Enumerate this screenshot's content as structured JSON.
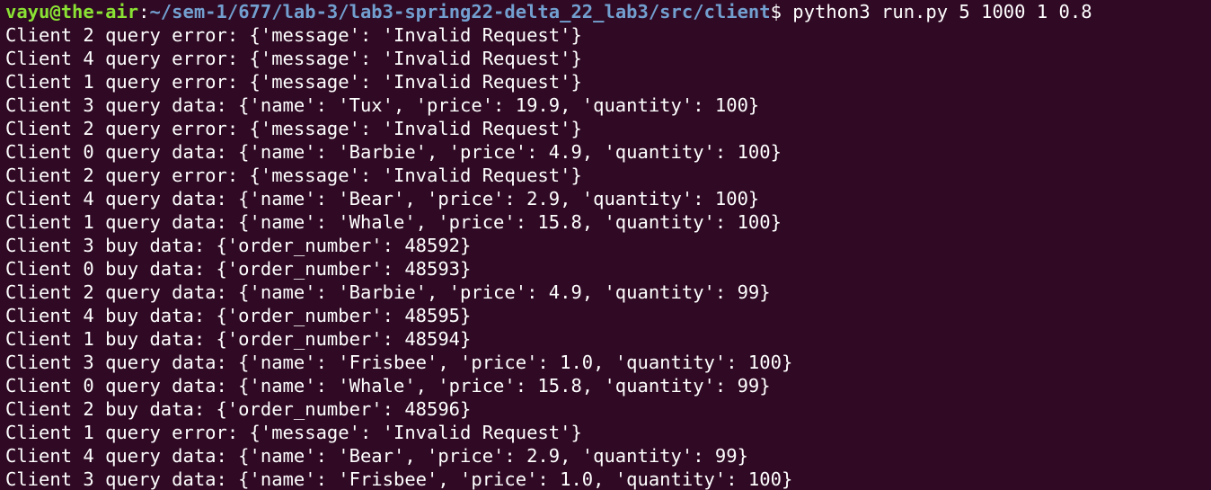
{
  "prompt": {
    "user_host": "vayu@the-air",
    "separator": ":",
    "path": "~/sem-1/677/lab-3/lab3-spring22-delta_22_lab3/src/client",
    "symbol": "$",
    "command": " python3 run.py 5 1000 1 0.8"
  },
  "output_lines": [
    "Client 2 query error: {'message': 'Invalid Request'}",
    "Client 4 query error: {'message': 'Invalid Request'}",
    "Client 1 query error: {'message': 'Invalid Request'}",
    "Client 3 query data: {'name': 'Tux', 'price': 19.9, 'quantity': 100}",
    "Client 2 query error: {'message': 'Invalid Request'}",
    "Client 0 query data: {'name': 'Barbie', 'price': 4.9, 'quantity': 100}",
    "Client 2 query error: {'message': 'Invalid Request'}",
    "Client 4 query data: {'name': 'Bear', 'price': 2.9, 'quantity': 100}",
    "Client 1 query data: {'name': 'Whale', 'price': 15.8, 'quantity': 100}",
    "Client 3 buy data: {'order_number': 48592}",
    "Client 0 buy data: {'order_number': 48593}",
    "Client 2 query data: {'name': 'Barbie', 'price': 4.9, 'quantity': 99}",
    "Client 4 buy data: {'order_number': 48595}",
    "Client 1 buy data: {'order_number': 48594}",
    "Client 3 query data: {'name': 'Frisbee', 'price': 1.0, 'quantity': 100}",
    "Client 0 query data: {'name': 'Whale', 'price': 15.8, 'quantity': 99}",
    "Client 2 buy data: {'order_number': 48596}",
    "Client 1 query error: {'message': 'Invalid Request'}",
    "Client 4 query data: {'name': 'Bear', 'price': 2.9, 'quantity': 99}",
    "Client 3 query data: {'name': 'Frisbee', 'price': 1.0, 'quantity': 100}"
  ]
}
